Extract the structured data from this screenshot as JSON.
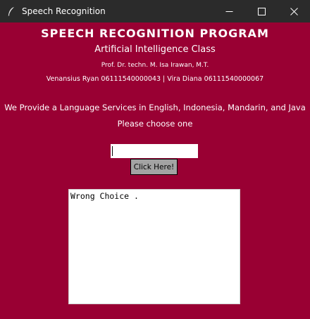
{
  "window": {
    "title": "Speech Recognition",
    "icons": {
      "app": "feather-icon",
      "minimize": "minimize-icon",
      "maximize": "maximize-icon",
      "close": "close-icon"
    }
  },
  "header": {
    "title": "SPEECH RECOGNITION PROGRAM",
    "subtitle": "Artificial Intelligence Class",
    "professor": "Prof. Dr. techn. M. Isa Irawan, M.T.",
    "authors": "Venansius Ryan 06111540000043  |  Vira Diana 06111540000067"
  },
  "body": {
    "services": "We Provide a Language Services in English, Indonesia, Mandarin, and Java",
    "prompt": "Please choose one"
  },
  "form": {
    "input_value": "",
    "button_label": "Click Here!"
  },
  "output": {
    "text": "Wrong Choice ."
  },
  "colors": {
    "background": "#990033",
    "titlebar": "#2b2b2b",
    "button": "#a3a3a3",
    "text": "#ffffff"
  }
}
